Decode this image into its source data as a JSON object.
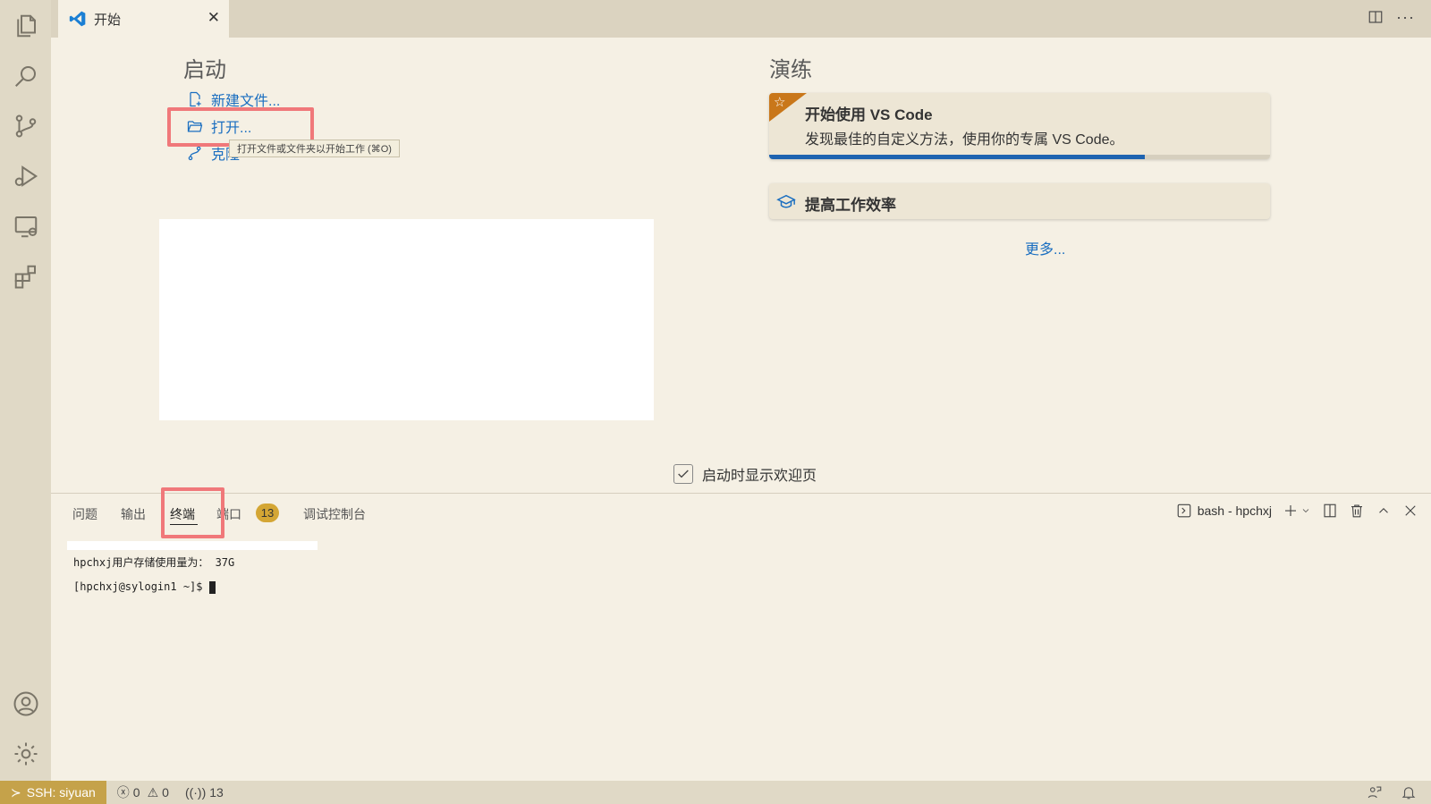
{
  "tab": {
    "label": "开始"
  },
  "welcome": {
    "start_heading": "启动",
    "new_file": "新建文件...",
    "open": "打开...",
    "clone_partial": "克隆",
    "tooltip": "打开文件或文件夹以开始工作 (⌘O)",
    "walkthrough_heading": "演练",
    "card1_title": "开始使用 VS Code",
    "card1_desc": "发现最佳的自定义方法，使用你的专属 VS Code。",
    "card1_progress": 0.75,
    "card2_title": "提高工作效率",
    "more": "更多...",
    "show_on_startup": "启动时显示欢迎页"
  },
  "panel": {
    "tabs": [
      "问题",
      "输出",
      "终端",
      "端口",
      "调试控制台"
    ],
    "ports_count": "13",
    "terminal_name": "bash - hpchxj",
    "line1": "hpchxj用户存储使用量为： 37G",
    "prompt": "[hpchxj@sylogin1 ~]$ "
  },
  "status": {
    "remote": "SSH: siyuan",
    "errors": "0",
    "warnings": "0",
    "ports": "13"
  }
}
